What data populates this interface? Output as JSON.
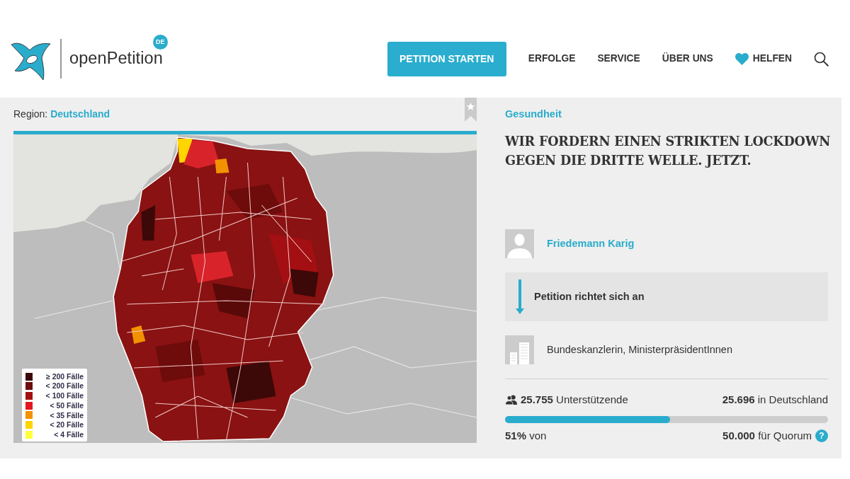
{
  "header": {
    "logo_text": "openPetition",
    "country_badge": "DE",
    "nav": [
      {
        "label": "PETITION STARTEN",
        "kind": "button"
      },
      {
        "label": "ERFOLGE",
        "kind": "link"
      },
      {
        "label": "SERVICE",
        "kind": "link"
      },
      {
        "label": "ÜBER UNS",
        "kind": "link"
      },
      {
        "label": "HELFEN",
        "kind": "heart"
      }
    ]
  },
  "map_panel": {
    "region_label": "Region:",
    "region": "Deutschland",
    "legend": [
      {
        "label": "≥ 200 Fälle",
        "color": "#3d0808"
      },
      {
        "label": "< 200 Fälle",
        "color": "#6e0b0b"
      },
      {
        "label": "< 100 Fälle",
        "color": "#a30f12"
      },
      {
        "label": "< 50 Fälle",
        "color": "#e2171f"
      },
      {
        "label": "< 35 Fälle",
        "color": "#f39200"
      },
      {
        "label": "< 20 Fälle",
        "color": "#ffd500"
      },
      {
        "label": "< 4 Fälle",
        "color": "#ffff3c"
      }
    ]
  },
  "petition": {
    "category": "Gesundheit",
    "title": "WIR FORDERN EINEN STRIKTEN LOCKDOWN GEGEN DIE DRITTE WELLE. JETZT.",
    "author": "Friedemann Karig",
    "recipient_heading": "Petition richtet sich an",
    "recipients": "Bundeskanzlerin, MinisterpräsidentInnen",
    "supporters": "**25.755** Unterstützende",
    "in_country": "**25.696** in Deutschland",
    "progress": {
      "level": 0.51
    },
    "percent": "**51%** von",
    "quorum": "**50.000** für Quorum",
    "quorum_help": "?"
  }
}
